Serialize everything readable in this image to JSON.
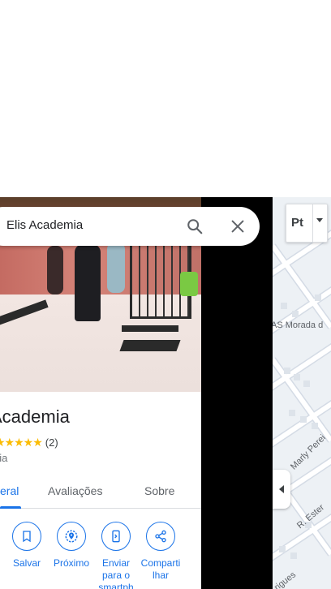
{
  "search": {
    "query": "Elis Academia"
  },
  "place": {
    "title": "Academia",
    "rating_count": "(2)",
    "stars": "★★★★★",
    "category": "nia"
  },
  "tabs": [
    {
      "label": "eral",
      "active": true
    },
    {
      "label": "Avaliações",
      "active": false
    },
    {
      "label": "Sobre",
      "active": false
    }
  ],
  "actions": [
    {
      "label": "Salvar",
      "icon": "bookmark-icon"
    },
    {
      "label": "Próximo",
      "icon": "nearby-icon"
    },
    {
      "label": "Enviar para o smartph",
      "icon": "send-to-phone-icon"
    },
    {
      "label": "Comparti lhar",
      "icon": "share-icon"
    }
  ],
  "map": {
    "labels": [
      "AS Morada d",
      "Marly Perei",
      "R. Ester",
      "rigues"
    ],
    "layer_button": "Pt"
  },
  "colors": {
    "accent": "#1a73e8",
    "star": "#fbbc04",
    "map_bg": "#edf1f5",
    "road": "#ffffff"
  }
}
